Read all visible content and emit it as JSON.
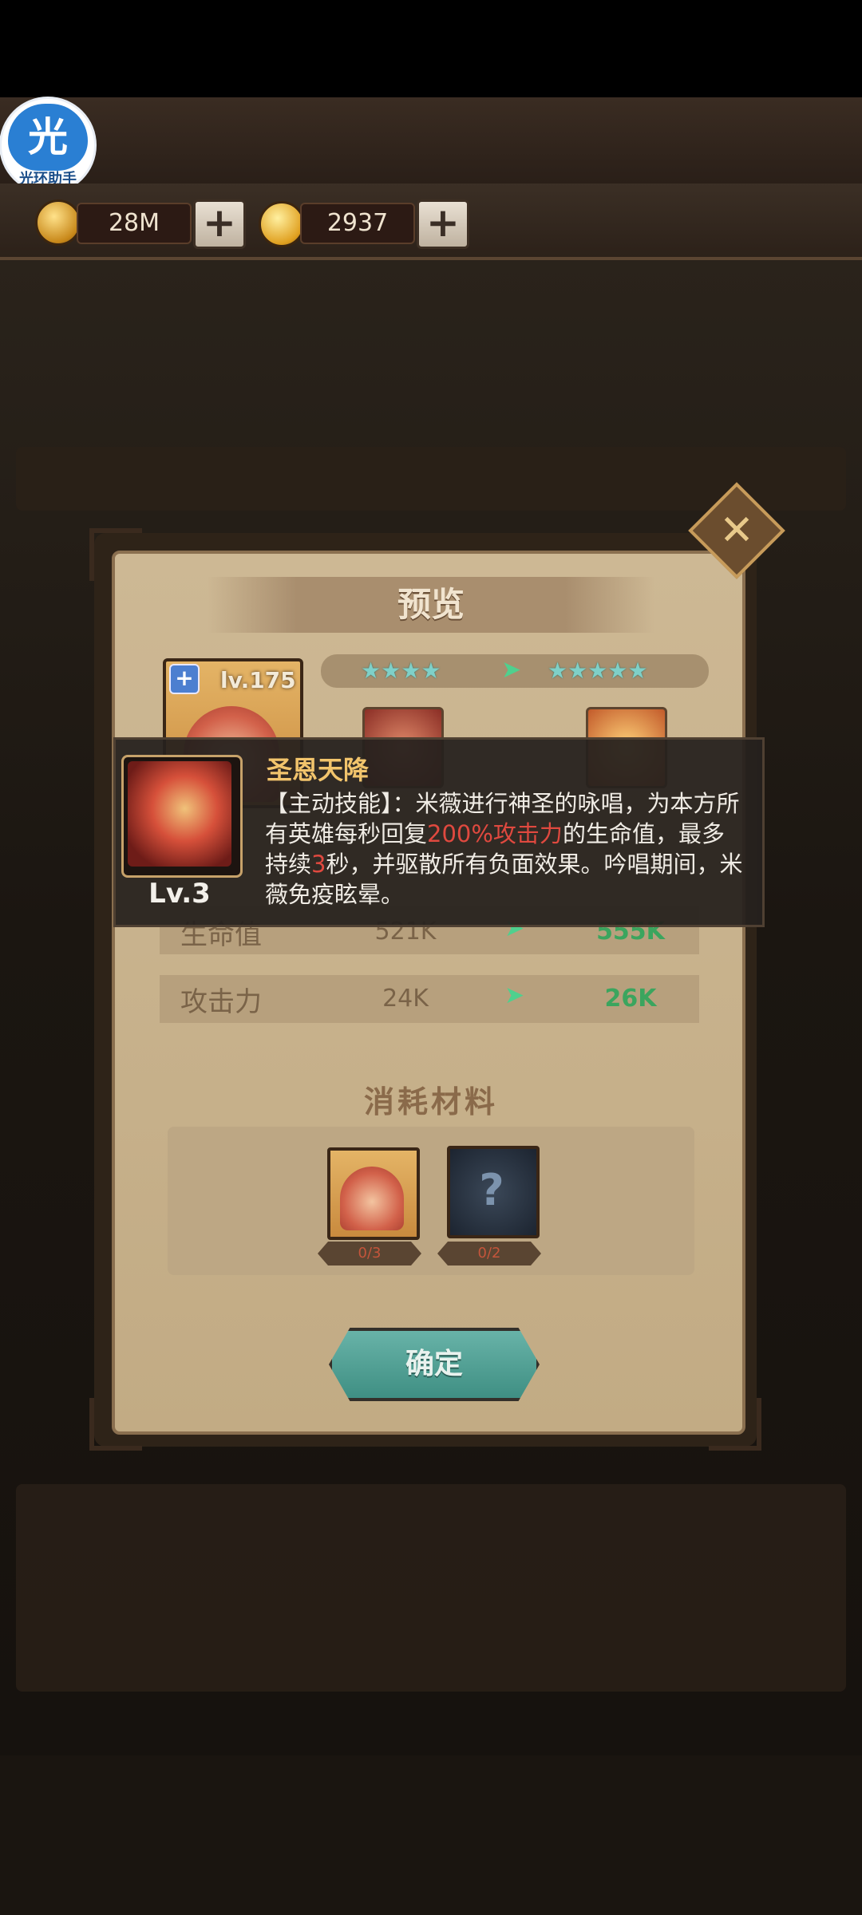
{
  "helper_badge": {
    "glyph": "光",
    "label": "光环助手"
  },
  "currency": {
    "gold": "28M",
    "gems": "2937",
    "plus": "+"
  },
  "modal": {
    "title": "预览",
    "close": "✕",
    "hero_level": "lv.175",
    "hero_plus": "+",
    "stars_before": 4,
    "stars_after": 5,
    "stats": [
      {
        "label": "生命值",
        "old": "521K",
        "new": "555K"
      },
      {
        "label": "攻击力",
        "old": "24K",
        "new": "26K"
      }
    ],
    "materials_title": "消耗材料",
    "materials": [
      {
        "name": "hero-copy",
        "count": "0/3"
      },
      {
        "name": "mystery-hero",
        "count": "0/2"
      }
    ],
    "confirm": "确定"
  },
  "tooltip": {
    "skill_level": "Lv.3",
    "skill_name": "圣恩天降",
    "desc_1": "【主动技能】：米薇进行神圣的咏唱，为本方所有英雄每秒回复",
    "desc_hl1": "200%攻击力",
    "desc_2": "的生命值，最多持续",
    "desc_hl2": "3",
    "desc_3": "秒，并驱散所有负面效果。吟唱期间，米薇免疫眩晕。"
  },
  "colors": {
    "accent_green": "#3ba55e",
    "highlight_red": "#e0493f",
    "title_gold": "#f2c46c"
  }
}
